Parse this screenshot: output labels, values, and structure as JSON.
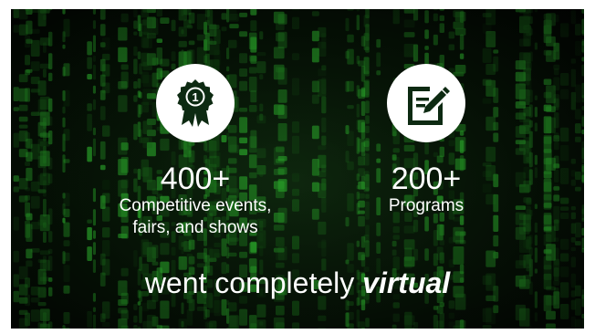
{
  "stats": [
    {
      "number": "400+",
      "line1": "Competitive events,",
      "line2": "fairs, and shows",
      "icon": "award-ribbon-icon"
    },
    {
      "number": "200+",
      "line1": "Programs",
      "icon": "edit-document-icon"
    }
  ],
  "tagline": {
    "text": "went completely",
    "emphasis": "virtual"
  },
  "colors": {
    "icon": "#0d2a12",
    "text": "#ffffff",
    "circle": "#ffffff"
  }
}
